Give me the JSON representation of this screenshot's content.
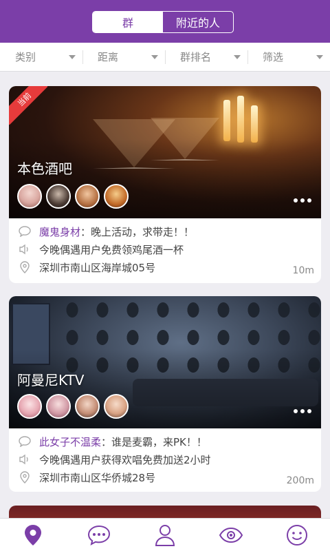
{
  "header": {
    "tabs": [
      {
        "label": "群",
        "active": true
      },
      {
        "label": "附近的人",
        "active": false
      }
    ]
  },
  "filters": [
    {
      "label": "类别"
    },
    {
      "label": "距离"
    },
    {
      "label": "群排名"
    },
    {
      "label": "筛选"
    }
  ],
  "cards": [
    {
      "badge": "当前",
      "name": "本色酒吧",
      "message_user": "魔鬼身材",
      "message_text": "：晚上活动，求带走！！",
      "promo": "今晚偶遇用户免费领鸡尾酒一杯",
      "address": "深圳市南山区海岸城05号",
      "distance": "10m"
    },
    {
      "name": "阿曼尼KTV",
      "message_user": "此女子不温柔",
      "message_text": "：谁是麦霸，来PK！！",
      "promo": "今晚偶遇用户获得欢唱免费加送2小时",
      "address": "深圳市南山区华侨城28号",
      "distance": "200m"
    }
  ],
  "tabbar": [
    "location-pin-icon",
    "chat-bubble-icon",
    "person-icon",
    "eye-icon",
    "smiley-icon"
  ],
  "colors": {
    "accent": "#7b3ea8",
    "badge": "#e63b3b",
    "tab_inactive": "#7b3ea8"
  }
}
